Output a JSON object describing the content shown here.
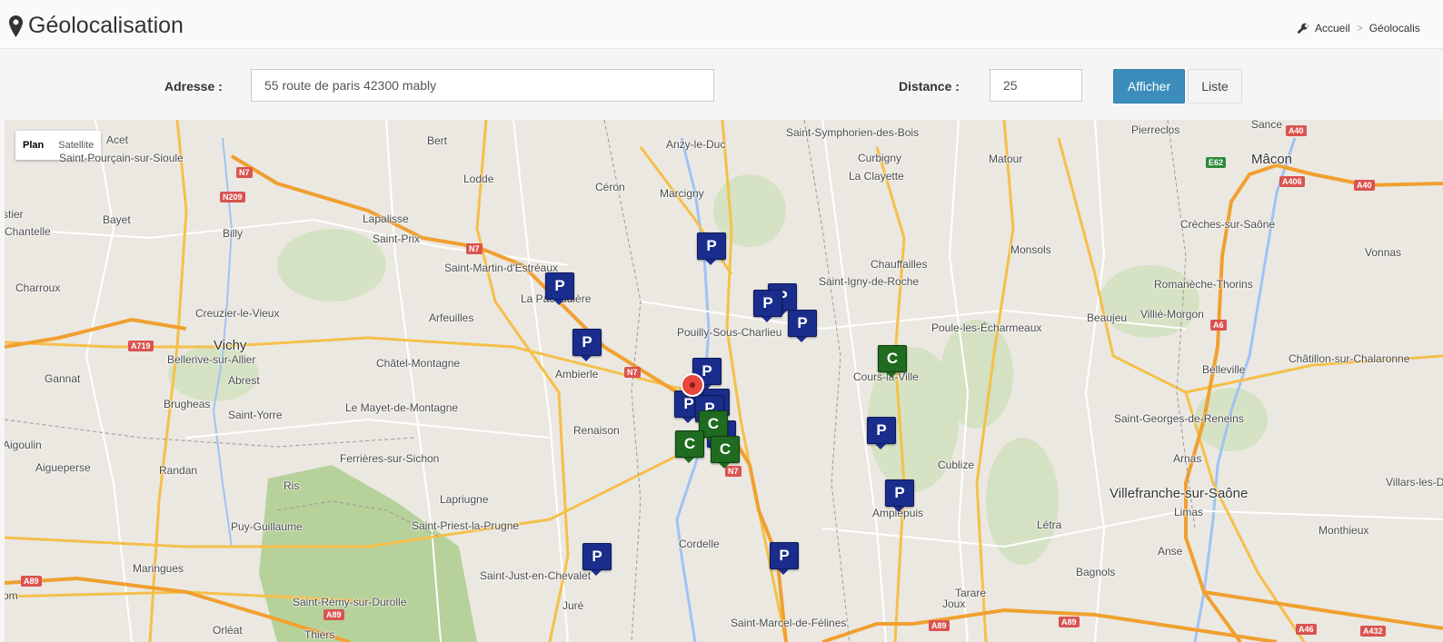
{
  "header": {
    "title": "Géolocalisation",
    "title_icon": "map-marker-icon",
    "breadcrumb": {
      "home": "Accueil",
      "separator": ">",
      "current": "Géolocalis"
    }
  },
  "toolbar": {
    "address_label": "Adresse :",
    "address_value": "55 route de paris 42300 mably",
    "distance_label": "Distance :",
    "distance_value": "25",
    "show_button": "Afficher",
    "list_button": "Liste"
  },
  "map": {
    "map_types": [
      "Plan",
      "Satellite"
    ],
    "selected_map_type": "Plan",
    "places": [
      "Saint-Symphorien-des-Bois",
      "Anzy-le-Duc",
      "Bert",
      "Lodde",
      "Céron",
      "Marcigny",
      "Curbigny",
      "La Clayette",
      "Matour",
      "Pierreclos",
      "Sance",
      "Mâcon",
      "Saint-Pourçain-sur-Sioule",
      "Bayet",
      "Billy",
      "Lapalisse",
      "Saint-Prix",
      "Saint-Martin-d'Estréaux",
      "La Pacaudière",
      "Chantelle",
      "Charroux",
      "Creuzier-le-Vieux",
      "Arfeuilles",
      "Vichy",
      "Bellerive-sur-Allier",
      "Abrest",
      "Châtel-Montagne",
      "Ambierle",
      "Pouilly-Sous-Charlieu",
      "Chauffailles",
      "Saint-Igny-de-Roche",
      "Poule-les-Écharmeaux",
      "Beaujeu",
      "Villié-Morgon",
      "Romanèche-Thorins",
      "Monsols",
      "Crèches-sur-Saône",
      "Vonnas",
      "Gannat",
      "Brugheas",
      "Saint-Yorre",
      "Le Mayet-de-Montagne",
      "Renaison",
      "Cours-la-Ville",
      "Belleville",
      "Châtillon-sur-Chalaronne",
      "Saint-Georges-de-Reneins",
      "Aigueperse",
      "Randan",
      "Ferrières-sur-Sichon",
      "Ris",
      "Lapriugne",
      "Saint-Priest-la-Prugne",
      "Cublize",
      "Amplepuis",
      "Arnas",
      "Villefranche-sur-Saône",
      "Limas",
      "Villars-les-D",
      "Puy-Guillaume",
      "Cordelle",
      "Létra",
      "Monthieux",
      "Maringues",
      "Saint-Just-en-Chevalet",
      "Bagnols",
      "Anse",
      "Saint-Rémy-sur-Durolle",
      "Juré",
      "Joux",
      "Tarare",
      "Orléat",
      "Saint-Marcel-de-Félines",
      "Thiers",
      "Aigoulin",
      "Acet",
      "stier",
      "om"
    ],
    "road_labels": [
      "N7",
      "N209",
      "N7",
      "N7",
      "A719",
      "A89",
      "A89",
      "A6",
      "E62",
      "A406",
      "A40",
      "A40",
      "N7",
      "A89",
      "A89",
      "A46",
      "A432"
    ],
    "markers": [
      {
        "type": "P",
        "label": "P"
      },
      {
        "type": "P",
        "label": "P"
      },
      {
        "type": "P",
        "label": "P"
      },
      {
        "type": "P",
        "label": "P"
      },
      {
        "type": "P",
        "label": "P"
      },
      {
        "type": "P",
        "label": "P"
      },
      {
        "type": "P",
        "label": "P"
      },
      {
        "type": "P",
        "label": "P"
      },
      {
        "type": "P",
        "label": "P"
      },
      {
        "type": "P",
        "label": "P"
      },
      {
        "type": "P",
        "label": "P"
      },
      {
        "type": "P",
        "label": "P"
      },
      {
        "type": "P",
        "label": "P"
      },
      {
        "type": "P",
        "label": "P"
      },
      {
        "type": "C",
        "label": "C"
      },
      {
        "type": "C",
        "label": "C"
      },
      {
        "type": "C",
        "label": "C"
      },
      {
        "type": "C",
        "label": "C"
      }
    ],
    "colors": {
      "parking_marker": "#1a2d8c",
      "c_marker": "#1f6b1f",
      "home_marker": "#e8473d",
      "primary_button": "#3c8dbc"
    }
  }
}
